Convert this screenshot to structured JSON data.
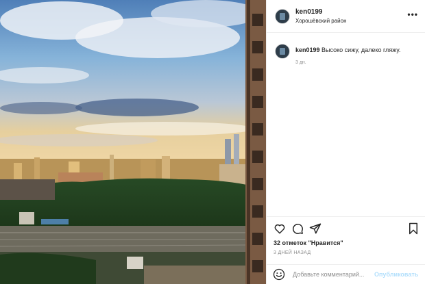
{
  "post": {
    "username": "ken0199",
    "location": "Хорошёвский район",
    "more_icon": "more-horizontal-icon",
    "caption_username": "ken0199",
    "caption_text": "Высоко сижу, далеко гляжу.",
    "caption_time": "3 дн.",
    "likes": "32 отметок \"Нравится\"",
    "post_time": "3 ДНЕЙ НАЗАД",
    "comment_placeholder": "Добавьте комментарий...",
    "publish_label": "Опубликовать",
    "icons": [
      "heart-icon",
      "comment-icon",
      "share-icon",
      "bookmark-icon",
      "emoji-icon"
    ],
    "colors": {
      "link_disabled": "#b2dffc",
      "muted": "#8e8e8e",
      "border": "#efefef"
    }
  }
}
